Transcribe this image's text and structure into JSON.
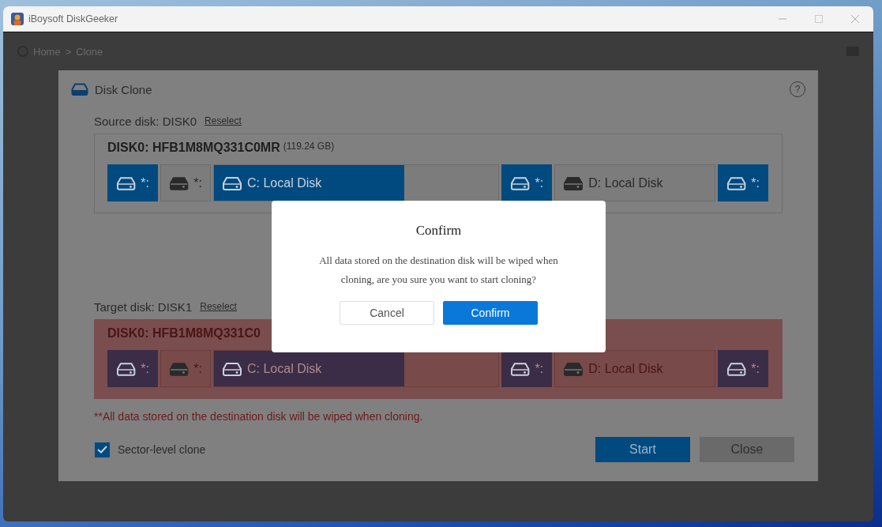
{
  "window": {
    "title": "iBoysoft DiskGeeker"
  },
  "breadcrumb": {
    "items": [
      "Home",
      "Clone"
    ],
    "separator": ">"
  },
  "dialog": {
    "title": "Disk Clone",
    "help": "?",
    "source": {
      "label": "Source disk: DISK0",
      "link": "Reselect",
      "warned": false,
      "disk_name": "DISK0: HFB1M8MQ331C0MR",
      "size": "(119.24 GB)",
      "partitions": [
        {
          "kind": "small",
          "label": "*:",
          "highlighted": true
        },
        {
          "kind": "small",
          "label": "*:",
          "highlighted": false
        },
        {
          "kind": "volume",
          "label": "C: Local Disk",
          "highlighted": false,
          "level": 0.67
        },
        {
          "kind": "small",
          "label": "*:",
          "highlighted": true
        },
        {
          "kind": "volume",
          "label": "D: Local Disk",
          "highlighted": false
        },
        {
          "kind": "small",
          "label": "*:",
          "highlighted": true
        }
      ]
    },
    "target": {
      "label": "Target disk: DISK1",
      "link": "Reselect",
      "warned": true,
      "disk_name": "DISK0: HFB1M8MQ331C0",
      "partitions": [
        {
          "kind": "small",
          "label": "*:",
          "highlighted": true
        },
        {
          "kind": "small",
          "label": "*:",
          "highlighted": false
        },
        {
          "kind": "volume",
          "label": "C: Local Disk",
          "highlighted": false,
          "level": 0.67
        },
        {
          "kind": "small",
          "label": "*:",
          "highlighted": true
        },
        {
          "kind": "volume",
          "label": "D: Local Disk",
          "highlighted": false
        },
        {
          "kind": "small",
          "label": "*:",
          "highlighted": true
        }
      ]
    },
    "warning": "**All data stored on the destination disk will be wiped when cloning.",
    "sector_clone": {
      "label": "Sector-level clone",
      "checked": true
    },
    "buttons": [
      {
        "label": "Start",
        "kind": "primary"
      },
      {
        "label": "Close",
        "kind": "secondary"
      }
    ]
  },
  "confirm": {
    "title": "Confirm",
    "message": "All data stored on the destination disk will be wiped when cloning, are you sure you want to start cloning?",
    "buttons": [
      {
        "label": "Cancel",
        "kind": "secondary"
      },
      {
        "label": "Confirm",
        "kind": "primary"
      }
    ]
  }
}
